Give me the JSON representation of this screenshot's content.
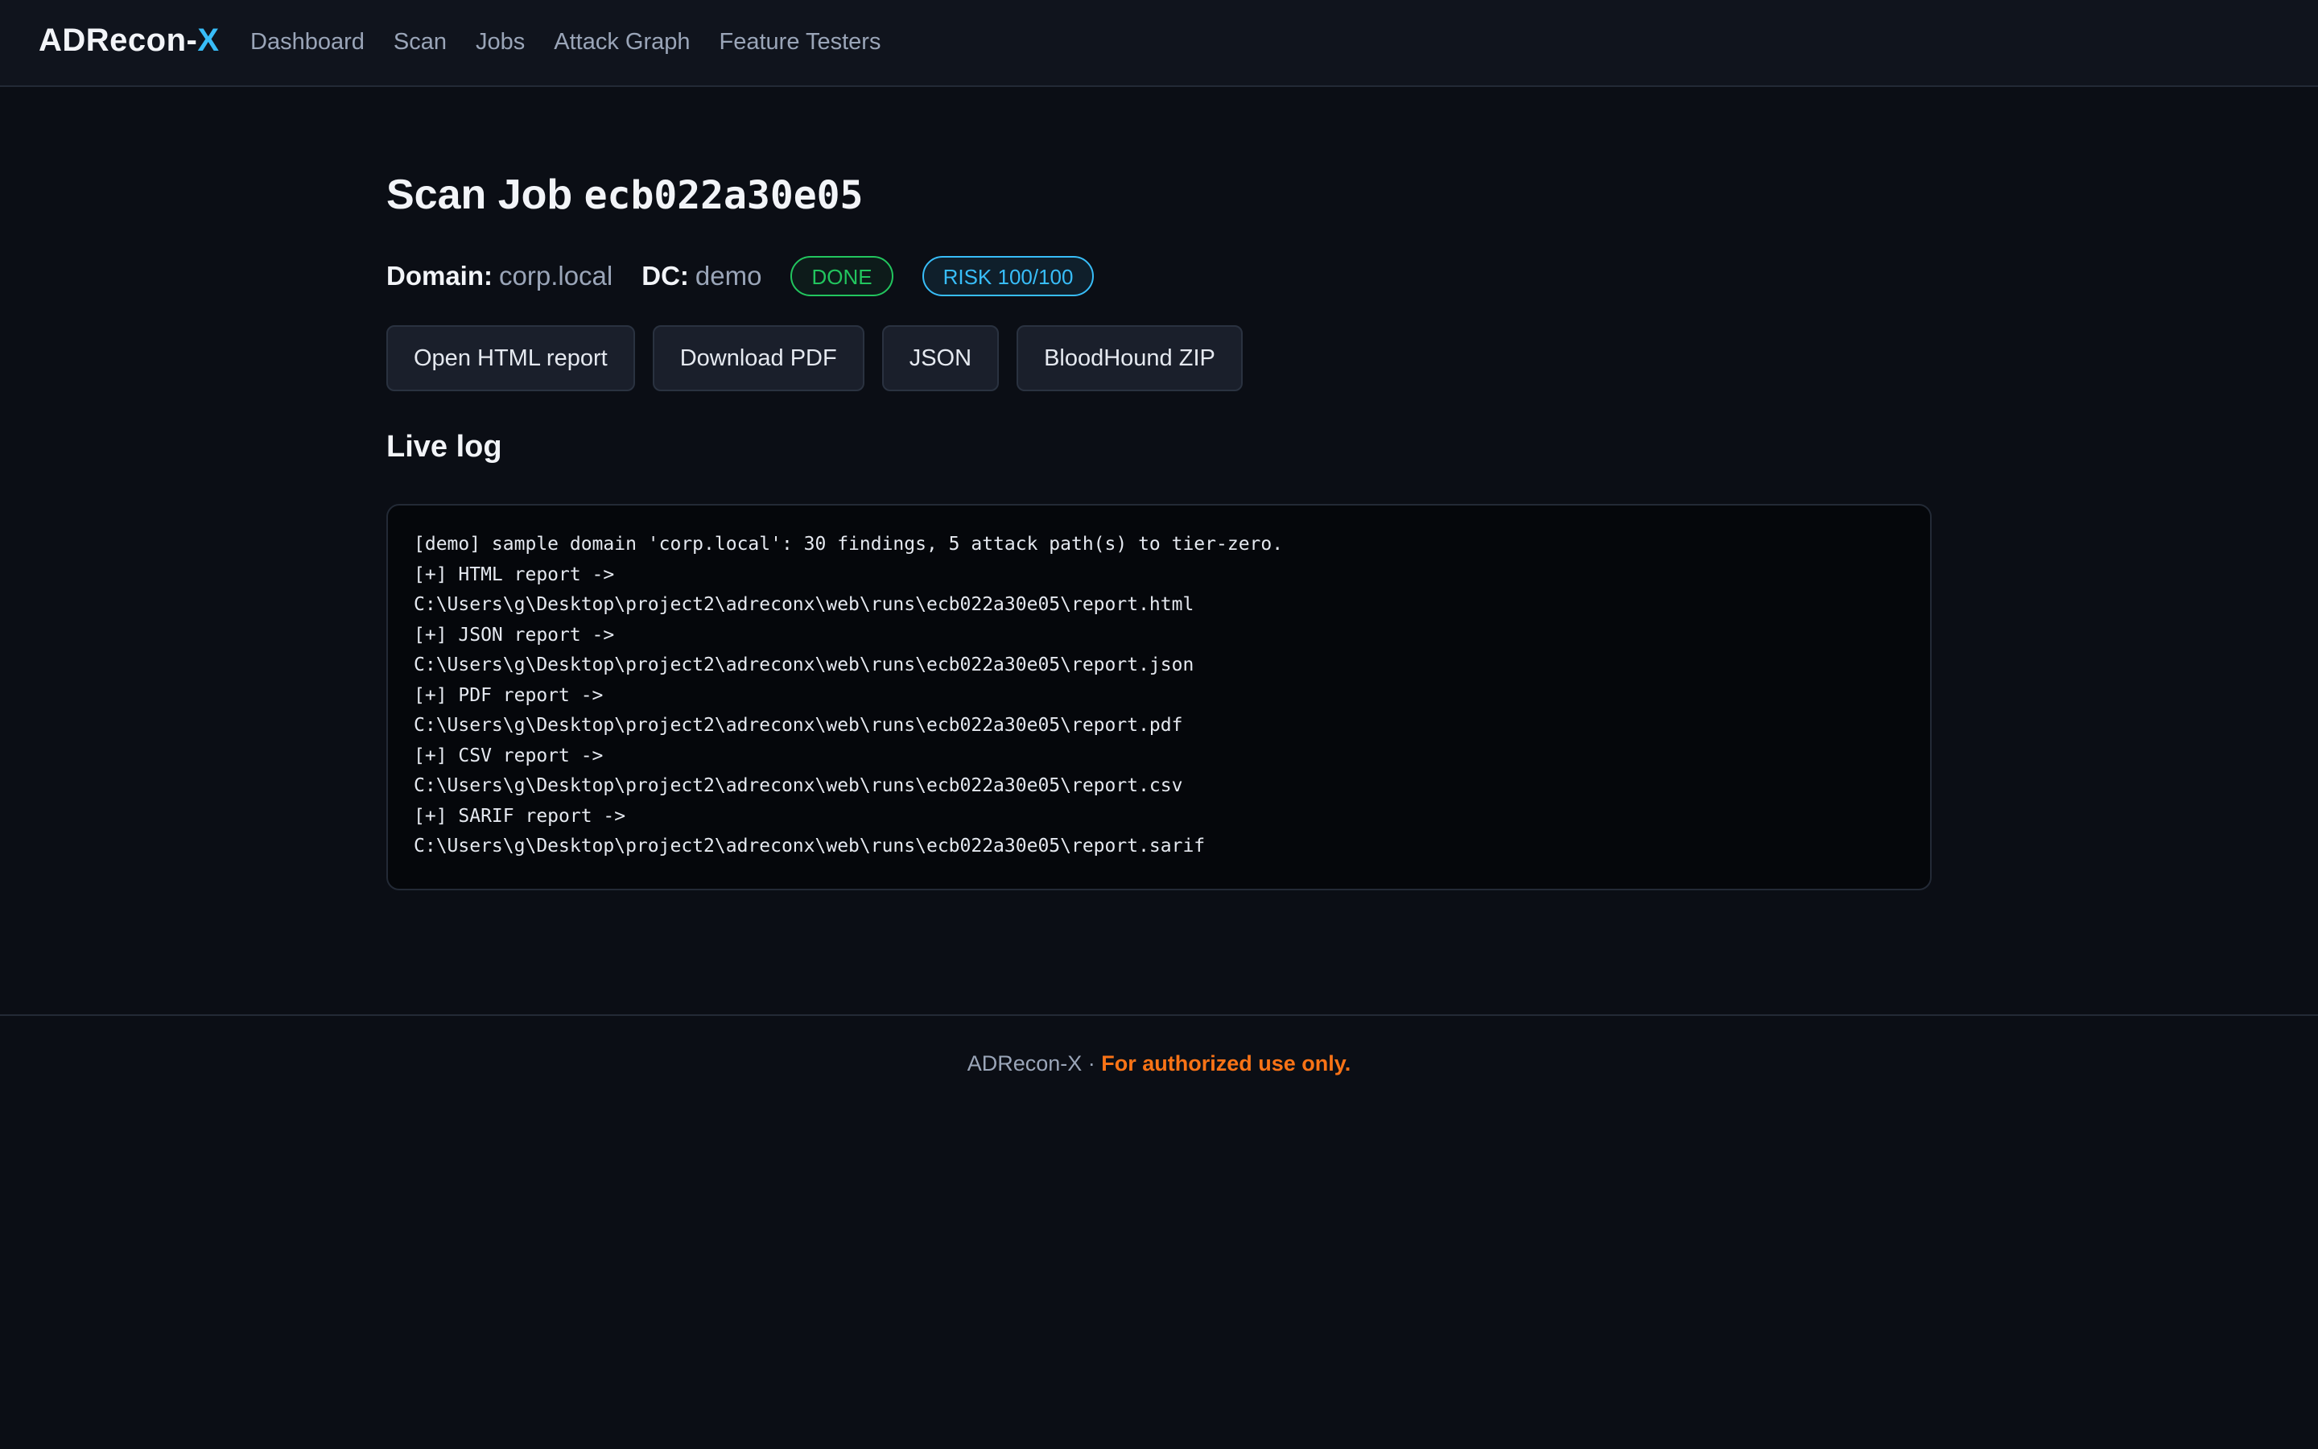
{
  "header": {
    "brand_main": "ADRecon-",
    "brand_accent": "X",
    "nav": [
      {
        "label": "Dashboard"
      },
      {
        "label": "Scan"
      },
      {
        "label": "Jobs"
      },
      {
        "label": "Attack Graph"
      },
      {
        "label": "Feature Testers"
      }
    ]
  },
  "job": {
    "title_prefix": "Scan Job",
    "job_id": "ecb022a30e05",
    "domain_label": "Domain:",
    "domain_value": "corp.local",
    "dc_label": "DC:",
    "dc_value": "demo",
    "status": "DONE",
    "risk": "RISK 100/100"
  },
  "actions": {
    "open_html": "Open HTML report",
    "download_pdf": "Download PDF",
    "json": "JSON",
    "bloodhound": "BloodHound ZIP"
  },
  "log": {
    "title": "Live log",
    "lines": [
      "[demo] sample domain 'corp.local': 30 findings, 5 attack path(s) to tier-zero.",
      "[+] HTML report ->",
      "C:\\Users\\g\\Desktop\\project2\\adreconx\\web\\runs\\ecb022a30e05\\report.html",
      "[+] JSON report ->",
      "C:\\Users\\g\\Desktop\\project2\\adreconx\\web\\runs\\ecb022a30e05\\report.json",
      "[+] PDF report ->",
      "C:\\Users\\g\\Desktop\\project2\\adreconx\\web\\runs\\ecb022a30e05\\report.pdf",
      "[+] CSV report ->",
      "C:\\Users\\g\\Desktop\\project2\\adreconx\\web\\runs\\ecb022a30e05\\report.csv",
      "[+] SARIF report ->",
      "C:\\Users\\g\\Desktop\\project2\\adreconx\\web\\runs\\ecb022a30e05\\report.sarif"
    ]
  },
  "footer": {
    "name": "ADRecon-X",
    "separator": " · ",
    "warning": "For authorized use only."
  },
  "colors": {
    "background": "#0b0e15",
    "accent": "#38bdf8",
    "success": "#22c55e",
    "warning": "#f97316"
  }
}
